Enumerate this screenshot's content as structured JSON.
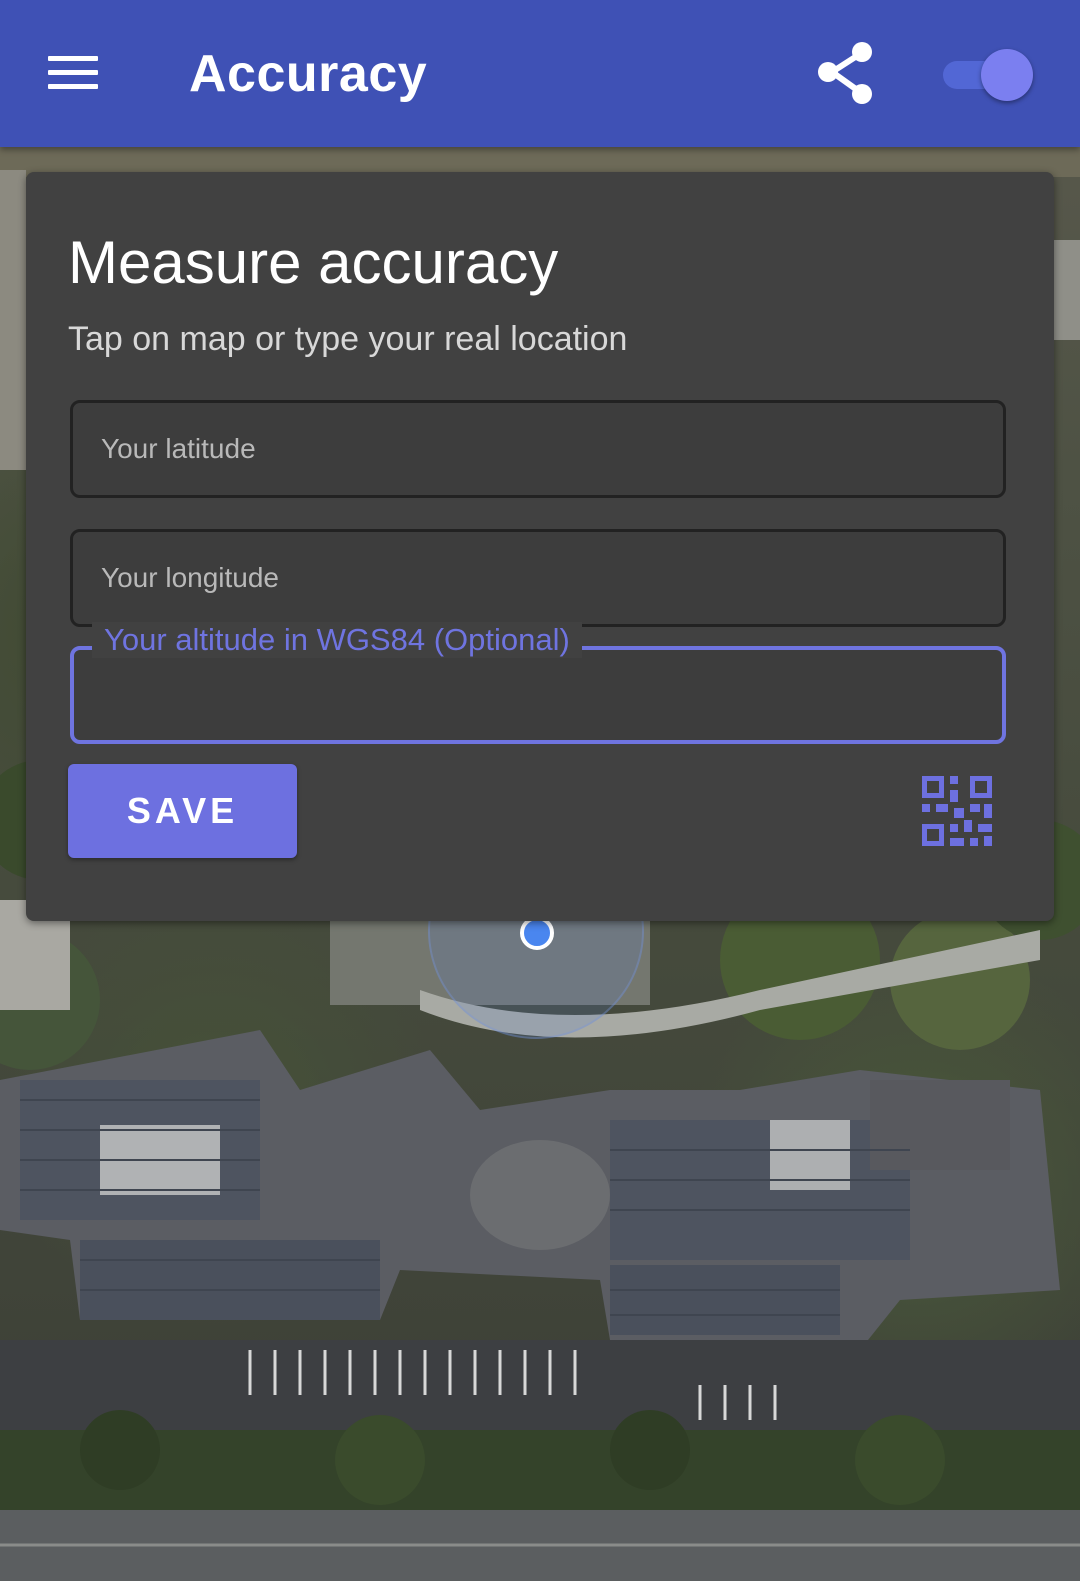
{
  "app_bar": {
    "title": "Accuracy",
    "menu_icon": "hamburger-menu-icon",
    "share_icon": "share-icon",
    "toggle_state": "on",
    "background_color": "#3f51b5"
  },
  "card": {
    "title": "Measure accuracy",
    "subtitle": "Tap on map or type your real location",
    "latitude": {
      "placeholder": "Your latitude",
      "value": ""
    },
    "longitude": {
      "placeholder": "Your longitude",
      "value": ""
    },
    "altitude": {
      "label": "Your altitude in WGS84 (Optional)",
      "value": ""
    },
    "save_label": "SAVE",
    "qr_icon": "qr-code-icon",
    "accent_color": "#6d70e0"
  },
  "map": {
    "type": "satellite",
    "marker_color": "#4a86ef"
  }
}
